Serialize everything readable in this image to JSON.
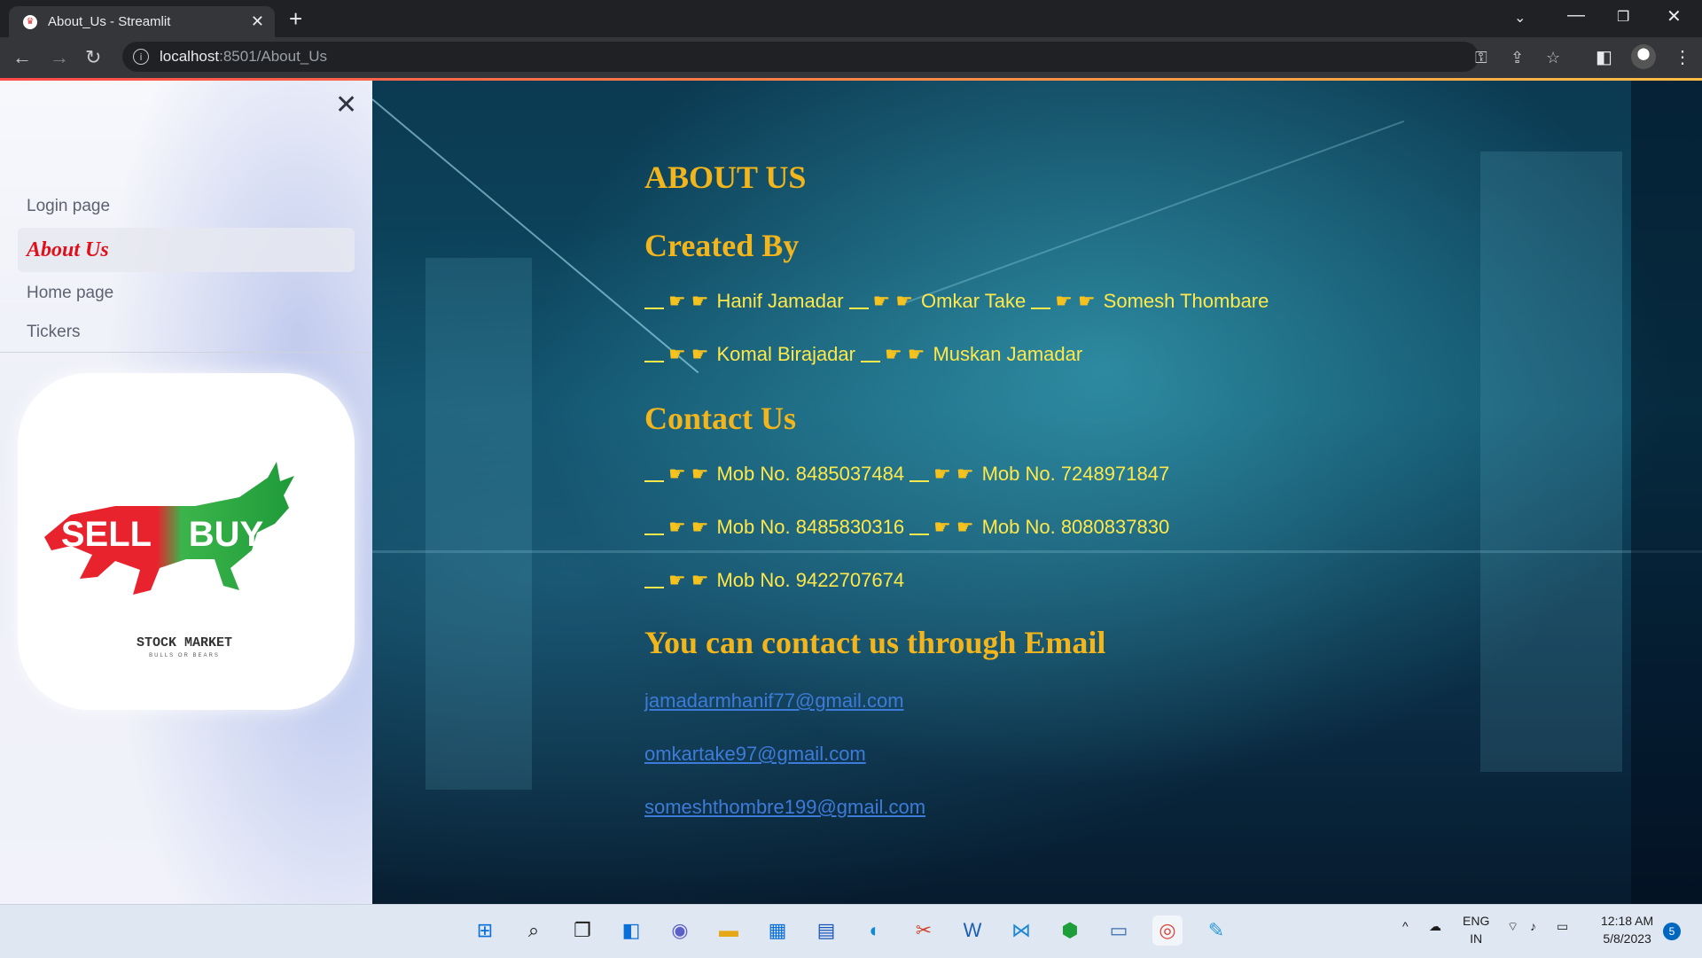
{
  "browser": {
    "tab_title": "About_Us - Streamlit",
    "url_host": "localhost",
    "url_path": ":8501/About_Us"
  },
  "sidebar": {
    "items": [
      {
        "label": "Login page",
        "active": false
      },
      {
        "label": "About Us",
        "active": true
      },
      {
        "label": "Home page",
        "active": false
      },
      {
        "label": "Tickers",
        "active": false
      }
    ],
    "logo": {
      "sell_text": "SELL",
      "buy_text": "BUY",
      "caption": "STOCK MARKET",
      "subcaption": "BULLS OR BEARS"
    }
  },
  "main": {
    "title": "ABOUT US",
    "created_heading": "Created By",
    "creators_row1": [
      "Hanif Jamadar",
      "Omkar Take",
      "Somesh Thombare"
    ],
    "creators_row2": [
      "Komal Birajadar",
      "Muskan Jamadar"
    ],
    "contact_heading": "Contact Us",
    "phones": [
      "Mob No. 8485037484",
      "Mob No. 7248971847",
      "Mob No. 8485830316",
      "Mob No. 8080837830",
      "Mob No. 9422707674"
    ],
    "email_heading": "You can contact us through Email",
    "emails": [
      "jamadarmhanif77@gmail.com",
      "omkartake97@gmail.com",
      "someshthombre199@gmail.com"
    ]
  },
  "taskbar": {
    "lang_top": "ENG",
    "lang_bottom": "IN",
    "time": "12:18 AM",
    "date": "5/8/2023",
    "notification_count": "5"
  },
  "colors": {
    "heading": "#f2b51b",
    "text": "#ffe84a",
    "link": "#3d7bd8",
    "active_nav": "#e0101a"
  }
}
